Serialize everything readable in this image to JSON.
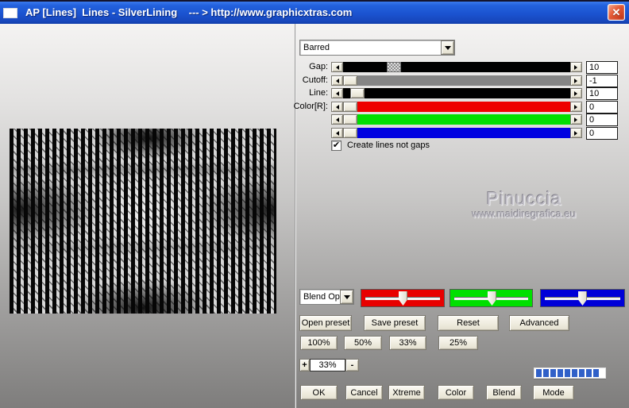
{
  "window": {
    "title": "AP [Lines]  Lines - SilverLining    --- > http://www.graphicxtras.com",
    "close_glyph": "✕",
    "titlebar_color": "#1b53d0"
  },
  "preset_dropdown": {
    "value": "Barred"
  },
  "sliders": {
    "rows": [
      {
        "label": "Gap:",
        "value": "10",
        "track_color": "#000000"
      },
      {
        "label": "Cutoff:",
        "value": "-1",
        "track_color": "#858585"
      },
      {
        "label": "Line:",
        "value": "10",
        "track_color": "#000000"
      },
      {
        "label": "Color[R]:",
        "value": "0",
        "track_color": "#ee0000"
      },
      {
        "label": "",
        "value": "0",
        "track_color": "#00dd00"
      },
      {
        "label": "",
        "value": "0",
        "track_color": "#0000e0"
      }
    ]
  },
  "options": {
    "create_lines_checkbox": {
      "label": "Create lines not gaps",
      "checked": true,
      "check_glyph": "✔"
    }
  },
  "watermark": {
    "name": "Pinuccia",
    "url": "www.maidiregrafica.eu"
  },
  "blend": {
    "dropdown_value": "Blend Opti",
    "channel_colors": {
      "red": "#e80000",
      "green": "#00e000",
      "blue": "#0000d8"
    }
  },
  "buttons": {
    "preset": [
      "Open preset",
      "Save preset",
      "Reset",
      "Advanced"
    ],
    "zoom_presets": [
      "100%",
      "50%",
      "33%",
      "25%"
    ],
    "zoom_stepper": {
      "plus": "+",
      "value": "33%",
      "minus": "-"
    },
    "actions": [
      "OK",
      "Cancel",
      "Xtreme",
      "Color",
      "Blend",
      "Mode"
    ]
  },
  "progress": {
    "segments": 9,
    "color": "#3060c8"
  }
}
